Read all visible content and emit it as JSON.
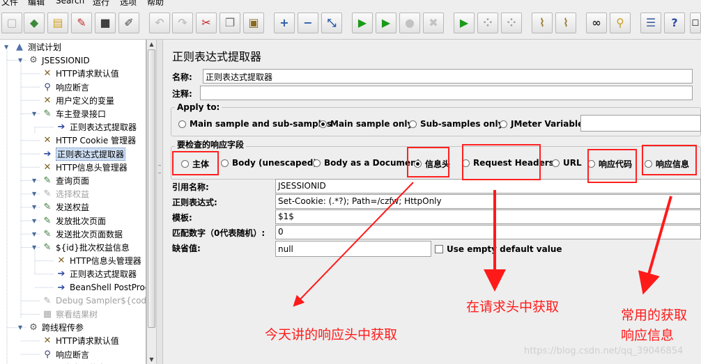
{
  "menu": [
    "文件",
    "编辑",
    "Search",
    "运行",
    "选项",
    "帮助"
  ],
  "toolbar_buttons": [
    {
      "name": "new-icon",
      "glyph": "▢",
      "color": "#b0b0b0"
    },
    {
      "name": "templates-icon",
      "glyph": "◆",
      "color": "#3a8a3a"
    },
    {
      "name": "open-icon",
      "glyph": "▤",
      "color": "#d4a020"
    },
    {
      "name": "close-icon",
      "glyph": "✎",
      "color": "#c03030"
    },
    {
      "name": "save-icon",
      "glyph": "■",
      "color": "#404040"
    },
    {
      "name": "save-as-icon",
      "glyph": "✐",
      "color": "#404040"
    },
    {
      "name": "undo-icon",
      "glyph": "↶",
      "color": "#c2c2c2",
      "disabled": true
    },
    {
      "name": "redo-icon",
      "glyph": "↷",
      "color": "#c2c2c2",
      "disabled": true
    },
    {
      "name": "cut-icon",
      "glyph": "✂",
      "color": "#c02020"
    },
    {
      "name": "copy-icon",
      "glyph": "❐",
      "color": "#707070"
    },
    {
      "name": "paste-icon",
      "glyph": "▣",
      "color": "#8a6a20"
    },
    {
      "name": "expand-icon",
      "glyph": "+",
      "color": "#2a5aa8"
    },
    {
      "name": "collapse-icon",
      "glyph": "−",
      "color": "#2a5aa8"
    },
    {
      "name": "toggle-icon",
      "glyph": "⤡",
      "color": "#2a5aa8"
    },
    {
      "name": "start-icon",
      "glyph": "▶",
      "color": "#1a9a1a"
    },
    {
      "name": "start-no-pause-icon",
      "glyph": "▶",
      "color": "#1a9a1a"
    },
    {
      "name": "stop-icon",
      "glyph": "●",
      "color": "#c2c2c2",
      "disabled": true
    },
    {
      "name": "shutdown-icon",
      "glyph": "✖",
      "color": "#c2c2c2",
      "disabled": true
    },
    {
      "name": "remote-start-icon",
      "glyph": "▶",
      "color": "#1a9a1a"
    },
    {
      "name": "remote-stop-icon",
      "glyph": "⁘",
      "color": "#9a9a9a"
    },
    {
      "name": "remote-shutdown-icon",
      "glyph": "⁘",
      "color": "#9a9a9a"
    },
    {
      "name": "clear-icon",
      "glyph": "⌇",
      "color": "#9a7a30"
    },
    {
      "name": "clear-all-icon",
      "glyph": "⌇",
      "color": "#9a7a30"
    },
    {
      "name": "search-icon",
      "glyph": "∞",
      "color": "#303030"
    },
    {
      "name": "reset-search-icon",
      "glyph": "⚲",
      "color": "#c8a020"
    },
    {
      "name": "function-helper-icon",
      "glyph": "☰",
      "color": "#4060a0"
    },
    {
      "name": "help-icon",
      "glyph": "?",
      "color": "#2a4aa0"
    }
  ],
  "tree": [
    {
      "label": "测试计划",
      "icon": "plan-icon",
      "glyph": "▲",
      "color": "#5070b0"
    },
    {
      "label": "JSESSIONID",
      "icon": "thread-group-icon",
      "glyph": "⚙",
      "color": "#606060"
    },
    {
      "label": "HTTP请求默认值",
      "icon": "config-icon",
      "glyph": "✕",
      "color": "#806020"
    },
    {
      "label": "响应断言",
      "icon": "assertion-icon",
      "glyph": "⚲",
      "color": "#304070"
    },
    {
      "label": "用户定义的变量",
      "icon": "config-icon",
      "glyph": "✕",
      "color": "#806020"
    },
    {
      "label": "车主登录接口",
      "icon": "sampler-icon",
      "glyph": "✎",
      "color": "#3a7a3a"
    },
    {
      "label": "正则表达式提取器",
      "icon": "post-processor-icon",
      "glyph": "➔",
      "color": "#2a4aa0"
    },
    {
      "label": "HTTP Cookie 管理器",
      "icon": "config-icon",
      "glyph": "✕",
      "color": "#806020"
    },
    {
      "label": "正则表达式提取器",
      "icon": "post-processor-icon",
      "glyph": "➔",
      "color": "#2a4aa0",
      "selected": true
    },
    {
      "label": "HTTP信息头管理器",
      "icon": "config-icon",
      "glyph": "✕",
      "color": "#806020"
    },
    {
      "label": "查询页面",
      "icon": "sampler-icon",
      "glyph": "✎",
      "color": "#3a7a3a"
    },
    {
      "label": "选择权益",
      "icon": "sampler-icon",
      "glyph": "✎",
      "color": "#a8a8a8",
      "dim": true
    },
    {
      "label": "发送权益",
      "icon": "sampler-icon",
      "glyph": "✎",
      "color": "#3a7a3a"
    },
    {
      "label": "发放批次页面",
      "icon": "sampler-icon",
      "glyph": "✎",
      "color": "#3a7a3a"
    },
    {
      "label": "发送批次页面数据",
      "icon": "sampler-icon",
      "glyph": "✎",
      "color": "#3a7a3a"
    },
    {
      "label": "${id}批次权益信息",
      "icon": "sampler-icon",
      "glyph": "✎",
      "color": "#3a7a3a"
    },
    {
      "label": "HTTP信息头管理器",
      "icon": "config-icon",
      "glyph": "✕",
      "color": "#806020"
    },
    {
      "label": "正则表达式提取器",
      "icon": "post-processor-icon",
      "glyph": "➔",
      "color": "#2a4aa0"
    },
    {
      "label": "BeanShell PostProc",
      "icon": "post-processor-icon",
      "glyph": "➔",
      "color": "#2a4aa0"
    },
    {
      "label": "Debug Sampler${code}",
      "icon": "sampler-icon",
      "glyph": "✎",
      "color": "#a8a8a8",
      "dim": true
    },
    {
      "label": "察看结果树",
      "icon": "listener-icon",
      "glyph": "▦",
      "color": "#a8a8a8",
      "dim": true
    },
    {
      "label": "跨线程传参",
      "icon": "thread-group-icon",
      "glyph": "⚙",
      "color": "#606060"
    },
    {
      "label": "HTTP请求默认值",
      "icon": "config-icon",
      "glyph": "✕",
      "color": "#806020"
    },
    {
      "label": "响应断言",
      "icon": "assertion-icon",
      "glyph": "⚲",
      "color": "#304070"
    },
    {
      "label": "用户定义的变量",
      "icon": "config-icon",
      "glyph": "✕",
      "color": "#806020"
    }
  ],
  "panel": {
    "title": "正则表达式提取器",
    "name_label": "名称:",
    "name_value": "正则表达式提取器",
    "comment_label": "注释:",
    "comment_value": "",
    "apply_to": {
      "title": "Apply to:",
      "options": [
        {
          "label": "Main sample and sub-samples",
          "checked": false
        },
        {
          "label": "Main sample only",
          "checked": true
        },
        {
          "label": "Sub-samples only",
          "checked": false
        },
        {
          "label": "JMeter Variable",
          "checked": false
        }
      ],
      "variable_value": ""
    },
    "field_check": {
      "title": "要检查的响应字段",
      "options": [
        {
          "label": "主体",
          "checked": false
        },
        {
          "label": "Body (unescaped)",
          "checked": false
        },
        {
          "label": "Body as a Document",
          "checked": false
        },
        {
          "label": "信息头",
          "checked": true
        },
        {
          "label": "Request Headers",
          "checked": false
        },
        {
          "label": "URL",
          "checked": false
        },
        {
          "label": "响应代码",
          "checked": false
        },
        {
          "label": "响应信息",
          "checked": false
        }
      ]
    },
    "ref_name_label": "引用名称:",
    "ref_name_value": "JSESSIONID",
    "regex_label": "正则表达式:",
    "regex_value": "Set-Cookie: (.*?); Path=/czfw; HttpOnly",
    "template_label": "模板:",
    "template_value": "$1$",
    "match_no_label": "匹配数字（0代表随机）:",
    "match_no_value": "0",
    "default_label": "缺省值:",
    "default_value": "null",
    "use_empty_label": "Use empty default value",
    "use_empty_checked": false
  },
  "annotations": {
    "today": "今天讲的响应头中获取",
    "request_headers": "在请求头中获取",
    "common_line1": "常用的获取",
    "common_line2": "响应信息",
    "color": "#ff1a1a"
  },
  "watermark": "https://blog.csdn.net/qq_39046854"
}
